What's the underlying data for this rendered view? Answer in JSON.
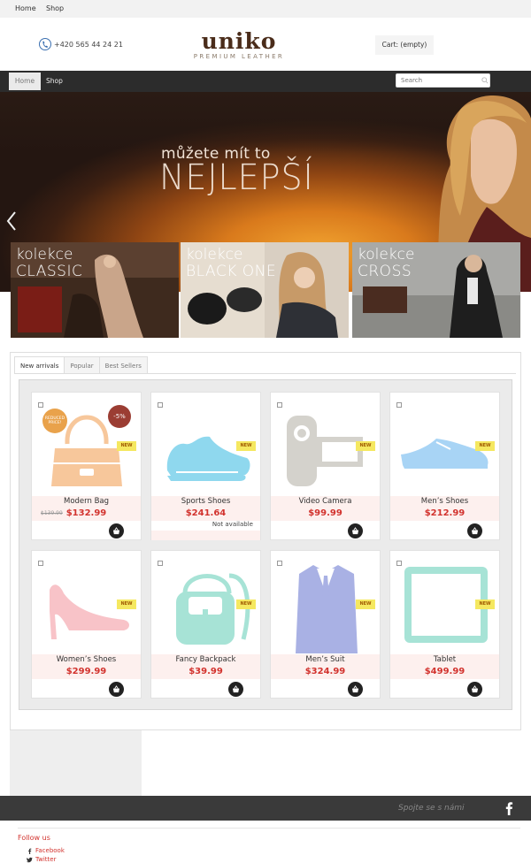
{
  "topbar": {
    "links": [
      "Home",
      "Shop"
    ]
  },
  "header": {
    "phone": "+420 565 44 24 21",
    "logo_brand": "uniko",
    "logo_tagline": "PREMIUM LEATHER",
    "cart_label": "Cart: (empty)"
  },
  "nav": {
    "items": [
      "Home",
      "Shop"
    ],
    "search_placeholder": "Search"
  },
  "hero": {
    "subtitle": "můžete mít to",
    "title": "NEJLEPŠÍ"
  },
  "collections": [
    {
      "label": "kolekce",
      "name": "CLASSIC"
    },
    {
      "label": "kolekce",
      "name": "BLACK ONE"
    },
    {
      "label": "kolekce",
      "name": "CROSS"
    }
  ],
  "tabs": [
    "New arrivals",
    "Popular",
    "Best Sellers"
  ],
  "products": [
    {
      "name": "Modern Bag",
      "price": "$132.99",
      "old_price": "$139.99",
      "badge_reduced": "REDUCED PRICE!",
      "badge_discount": "-5%",
      "icon": "bag-icon",
      "color": "#f7c79b",
      "is_new": false
    },
    {
      "name": "Sports Shoes",
      "price": "$241.64",
      "availability": "Not available",
      "icon": "sneaker-icon",
      "color": "#8fd8ee",
      "is_new": true
    },
    {
      "name": "Video Camera",
      "price": "$99.99",
      "icon": "camera-icon",
      "color": "#d4d2cc",
      "is_new": true
    },
    {
      "name": "Men’s Shoes",
      "price": "$212.99",
      "icon": "shoe-icon",
      "color": "#a8d4f5",
      "is_new": true
    },
    {
      "name": "Women’s Shoes",
      "price": "$299.99",
      "icon": "heel-icon",
      "color": "#f8c3c8",
      "is_new": true
    },
    {
      "name": "Fancy Backpack",
      "price": "$39.99",
      "icon": "backpack-icon",
      "color": "#a7e3d6",
      "is_new": true
    },
    {
      "name": "Men’s Suit",
      "price": "$324.99",
      "icon": "suit-icon",
      "color": "#a9b1e4",
      "is_new": true
    },
    {
      "name": "Tablet",
      "price": "$499.99",
      "icon": "tablet-icon",
      "color": "#a7e3d6",
      "is_new": true
    }
  ],
  "new_badge": "NEW",
  "footer": {
    "connect": "Spojte se s námi",
    "follow_title": "Follow us",
    "social": [
      "Facebook",
      "Twitter"
    ]
  },
  "colors": {
    "accent": "#d2332e",
    "nav_bg": "#2c2c2c",
    "footer_bg": "#3a3a3a"
  }
}
